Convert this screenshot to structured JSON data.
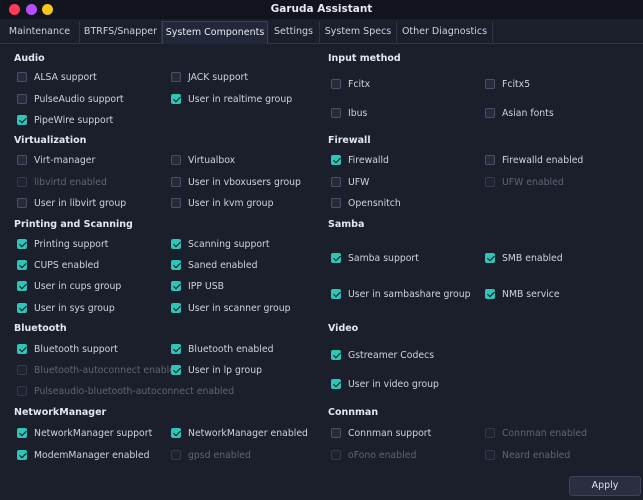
{
  "window": {
    "title": "Garuda Assistant",
    "controls": [
      {
        "name": "close",
        "color": "#ff3b5c"
      },
      {
        "name": "minimize",
        "color": "#b54dff"
      },
      {
        "name": "maximize",
        "color": "#f5c518"
      }
    ]
  },
  "tabs": [
    {
      "label": "Maintenance",
      "active": false
    },
    {
      "label": "BTRFS/Snapper",
      "active": false
    },
    {
      "label": "System Components",
      "active": true
    },
    {
      "label": "Settings",
      "active": false
    },
    {
      "label": "System Specs",
      "active": false
    },
    {
      "label": "Other Diagnostics",
      "active": false
    }
  ],
  "left": {
    "audio": {
      "title": "Audio",
      "items": [
        {
          "label": "ALSA support",
          "checked": false,
          "enabled": true
        },
        {
          "label": "JACK support",
          "checked": false,
          "enabled": true
        },
        {
          "label": "PulseAudio support",
          "checked": false,
          "enabled": true
        },
        {
          "label": "User in realtime group",
          "checked": true,
          "enabled": true
        },
        {
          "label": "PipeWire support",
          "checked": true,
          "enabled": true
        }
      ]
    },
    "virtualization": {
      "title": "Virtualization",
      "items": [
        {
          "label": "Virt-manager",
          "checked": false,
          "enabled": true
        },
        {
          "label": "Virtualbox",
          "checked": false,
          "enabled": true
        },
        {
          "label": "libvirtd enabled",
          "checked": false,
          "enabled": false
        },
        {
          "label": "User in vboxusers group",
          "checked": false,
          "enabled": true
        },
        {
          "label": "User in libvirt group",
          "checked": false,
          "enabled": true
        },
        {
          "label": "User in kvm group",
          "checked": false,
          "enabled": true
        }
      ]
    },
    "printing": {
      "title": "Printing and Scanning",
      "items": [
        {
          "label": "Printing support",
          "checked": true,
          "enabled": true
        },
        {
          "label": "Scanning support",
          "checked": true,
          "enabled": true
        },
        {
          "label": "CUPS enabled",
          "checked": true,
          "enabled": true
        },
        {
          "label": "Saned enabled",
          "checked": true,
          "enabled": true
        },
        {
          "label": "User in cups group",
          "checked": true,
          "enabled": true
        },
        {
          "label": "IPP USB",
          "checked": true,
          "enabled": true
        },
        {
          "label": "User in sys group",
          "checked": true,
          "enabled": true
        },
        {
          "label": "User in scanner group",
          "checked": true,
          "enabled": true
        }
      ]
    },
    "bluetooth": {
      "title": "Bluetooth",
      "items": [
        {
          "label": "Bluetooth support",
          "checked": true,
          "enabled": true
        },
        {
          "label": "Bluetooth enabled",
          "checked": true,
          "enabled": true
        },
        {
          "label": "Bluetooth-autoconnect enabled",
          "checked": false,
          "enabled": false
        },
        {
          "label": "User in lp group",
          "checked": true,
          "enabled": true
        },
        {
          "label": "Pulseaudio-bluetooth-autoconnect enabled",
          "checked": false,
          "enabled": false
        }
      ]
    },
    "networkmanager": {
      "title": "NetworkManager",
      "items": [
        {
          "label": "NetworkManager support",
          "checked": true,
          "enabled": true
        },
        {
          "label": "NetworkManager enabled",
          "checked": true,
          "enabled": true
        },
        {
          "label": "ModemManager enabled",
          "checked": true,
          "enabled": true
        },
        {
          "label": "gpsd enabled",
          "checked": false,
          "enabled": false
        }
      ]
    }
  },
  "right": {
    "input": {
      "title": "Input method",
      "items": [
        {
          "label": "Fcitx",
          "checked": false,
          "enabled": true
        },
        {
          "label": "Fcitx5",
          "checked": false,
          "enabled": true
        },
        {
          "label": "Ibus",
          "checked": false,
          "enabled": true
        },
        {
          "label": "Asian fonts",
          "checked": false,
          "enabled": true
        }
      ]
    },
    "firewall": {
      "title": "Firewall",
      "items": [
        {
          "label": "Firewalld",
          "checked": true,
          "enabled": true
        },
        {
          "label": "Firewalld enabled",
          "checked": false,
          "enabled": true
        },
        {
          "label": "UFW",
          "checked": false,
          "enabled": true
        },
        {
          "label": "UFW enabled",
          "checked": false,
          "enabled": false
        },
        {
          "label": "Opensnitch",
          "checked": false,
          "enabled": true
        }
      ]
    },
    "samba": {
      "title": "Samba",
      "items": [
        {
          "label": "Samba support",
          "checked": true,
          "enabled": true
        },
        {
          "label": "SMB enabled",
          "checked": true,
          "enabled": true
        },
        {
          "label": "User in sambashare group",
          "checked": true,
          "enabled": true
        },
        {
          "label": "NMB service",
          "checked": true,
          "enabled": true
        }
      ]
    },
    "video": {
      "title": "Video",
      "items": [
        {
          "label": "Gstreamer Codecs",
          "checked": true,
          "enabled": true
        },
        {
          "label": "User in video group",
          "checked": true,
          "enabled": true
        }
      ]
    },
    "connman": {
      "title": "Connman",
      "items": [
        {
          "label": "Connman support",
          "checked": false,
          "enabled": true
        },
        {
          "label": "Connman enabled",
          "checked": false,
          "enabled": false
        },
        {
          "label": "oFono enabled",
          "checked": false,
          "enabled": false
        },
        {
          "label": "Neard enabled",
          "checked": false,
          "enabled": false
        }
      ]
    }
  },
  "buttons": {
    "apply": "Apply"
  }
}
